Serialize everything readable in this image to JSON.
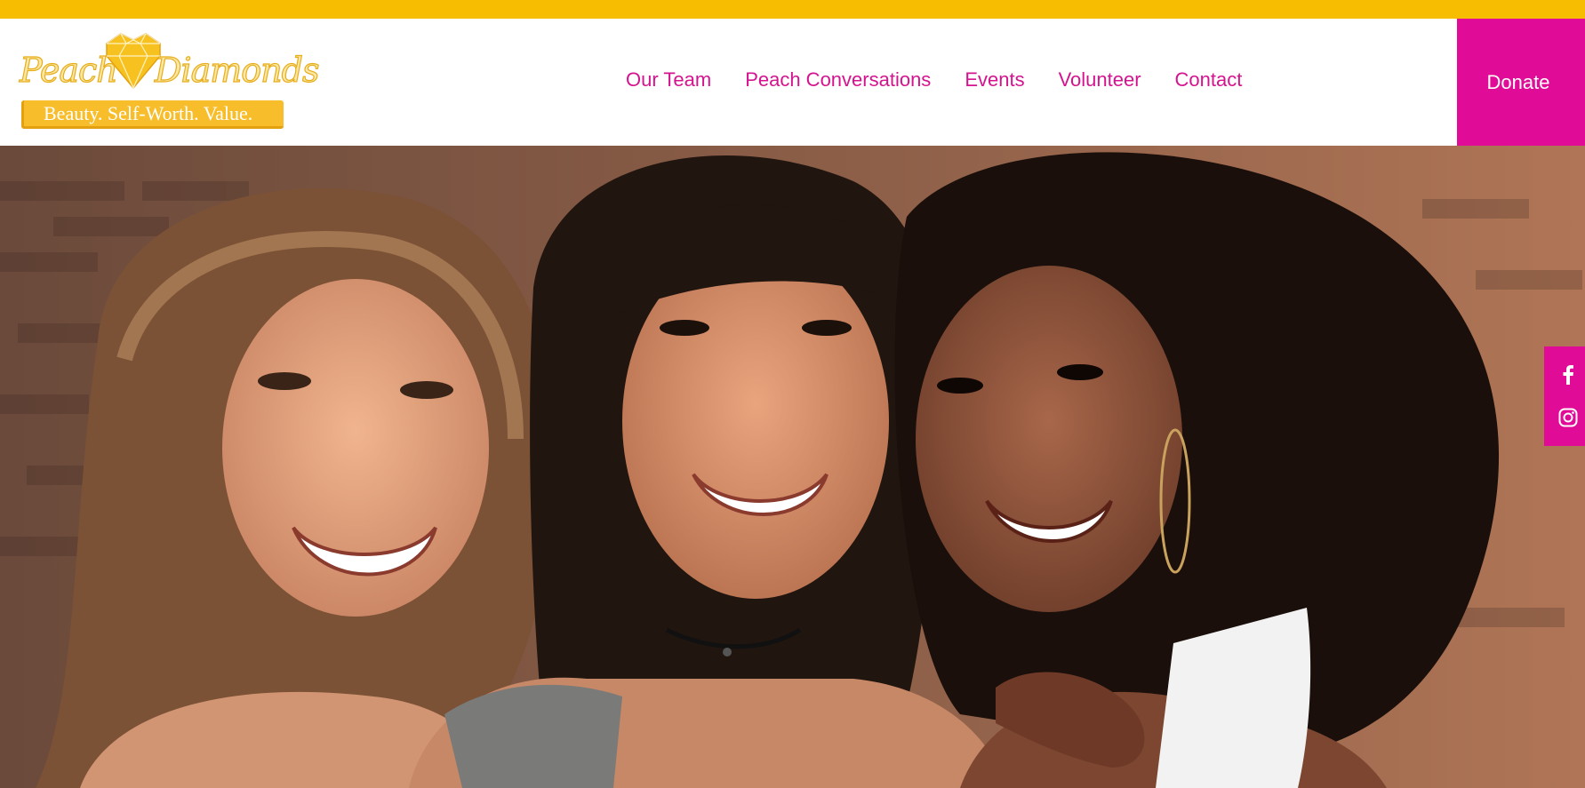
{
  "brand": {
    "name_part1": "Peach",
    "name_part2": "Diamonds",
    "tagline": "Beauty. Self-Worth. Value.",
    "colors": {
      "yellow": "#f7bd00",
      "magenta": "#e00b96",
      "nav_text": "#d4148e"
    }
  },
  "nav": {
    "items": [
      {
        "label": "Our Team"
      },
      {
        "label": "Peach Conversations"
      },
      {
        "label": "Events"
      },
      {
        "label": "Volunteer"
      },
      {
        "label": "Contact"
      }
    ]
  },
  "donate": {
    "label": "Donate"
  },
  "social": {
    "icons": [
      "facebook-icon",
      "instagram-icon"
    ]
  },
  "hero": {
    "image": "photo-three-smiling-women"
  }
}
